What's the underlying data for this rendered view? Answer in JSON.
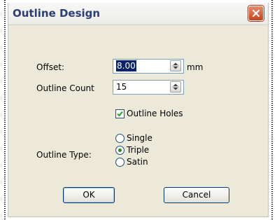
{
  "dialog": {
    "title": "Outline Design"
  },
  "offset": {
    "label": "Offset:",
    "value": "8.00",
    "unit": "mm"
  },
  "outline_count": {
    "label": "Outline Count",
    "value": "15"
  },
  "outline_holes": {
    "label": "Outline Holes",
    "checked": true
  },
  "outline_type": {
    "label": "Outline Type:",
    "options": [
      {
        "label": "Single",
        "selected": false
      },
      {
        "label": "Triple",
        "selected": true
      },
      {
        "label": "Satin",
        "selected": false
      }
    ]
  },
  "buttons": {
    "ok": "OK",
    "cancel": "Cancel"
  },
  "colors": {
    "title_text": "#2b3f70",
    "close_button": "#c8431d",
    "dialog_bg": "#ece9d8",
    "radio_dot": "#2a8a2a"
  },
  "icons": {
    "close": "close-icon",
    "spin": "spin-arrows-icon",
    "check": "checkmark-icon"
  }
}
